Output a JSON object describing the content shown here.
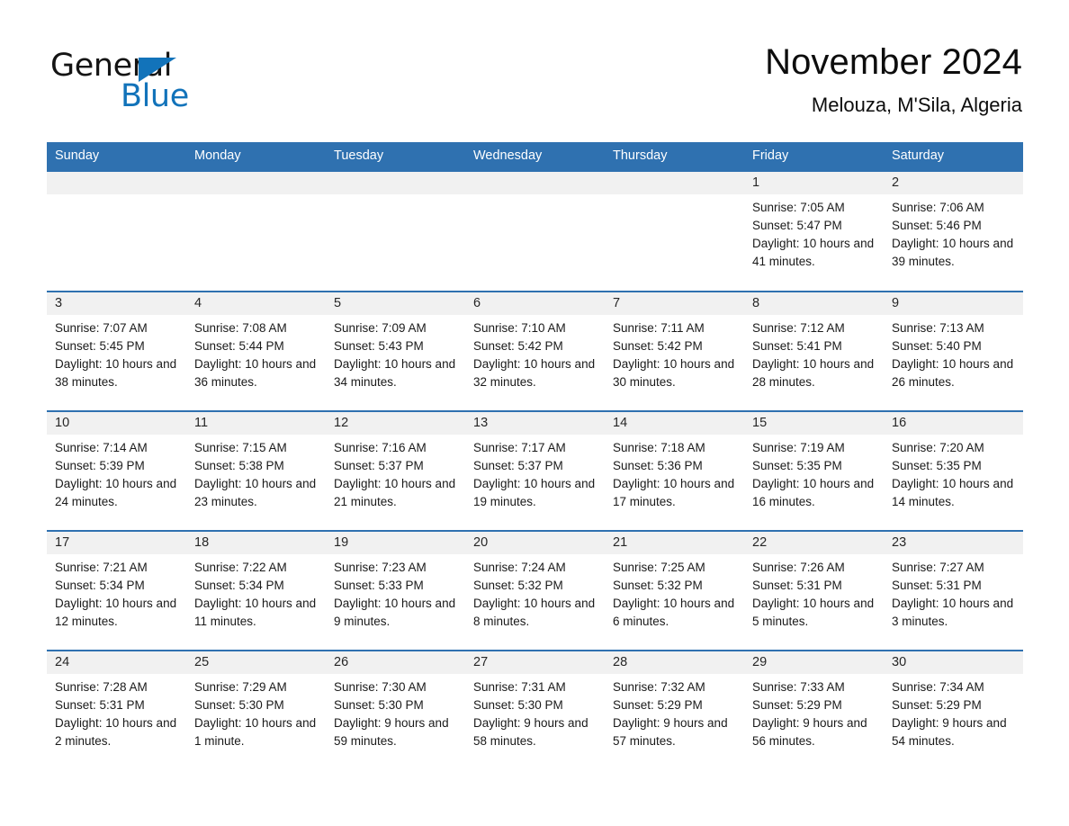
{
  "brand": {
    "word_one": "General",
    "word_two": "Blue",
    "triangle_icon": "triangle-icon",
    "accent_color": "#1273ba"
  },
  "header": {
    "title": "November 2024",
    "subtitle": "Melouza, M'Sila, Algeria"
  },
  "theme": {
    "header_blue": "#2f71b0",
    "daynum_gray": "#f1f1f1",
    "text": "#1a1a1a"
  },
  "calendar": {
    "weekday_headers": [
      "Sunday",
      "Monday",
      "Tuesday",
      "Wednesday",
      "Thursday",
      "Friday",
      "Saturday"
    ],
    "weeks": [
      [
        {
          "day": "",
          "blank": true
        },
        {
          "day": "",
          "blank": true
        },
        {
          "day": "",
          "blank": true
        },
        {
          "day": "",
          "blank": true
        },
        {
          "day": "",
          "blank": true
        },
        {
          "day": "1",
          "sunrise": "Sunrise: 7:05 AM",
          "sunset": "Sunset: 5:47 PM",
          "daylight": "Daylight: 10 hours and 41 minutes."
        },
        {
          "day": "2",
          "sunrise": "Sunrise: 7:06 AM",
          "sunset": "Sunset: 5:46 PM",
          "daylight": "Daylight: 10 hours and 39 minutes."
        }
      ],
      [
        {
          "day": "3",
          "sunrise": "Sunrise: 7:07 AM",
          "sunset": "Sunset: 5:45 PM",
          "daylight": "Daylight: 10 hours and 38 minutes."
        },
        {
          "day": "4",
          "sunrise": "Sunrise: 7:08 AM",
          "sunset": "Sunset: 5:44 PM",
          "daylight": "Daylight: 10 hours and 36 minutes."
        },
        {
          "day": "5",
          "sunrise": "Sunrise: 7:09 AM",
          "sunset": "Sunset: 5:43 PM",
          "daylight": "Daylight: 10 hours and 34 minutes."
        },
        {
          "day": "6",
          "sunrise": "Sunrise: 7:10 AM",
          "sunset": "Sunset: 5:42 PM",
          "daylight": "Daylight: 10 hours and 32 minutes."
        },
        {
          "day": "7",
          "sunrise": "Sunrise: 7:11 AM",
          "sunset": "Sunset: 5:42 PM",
          "daylight": "Daylight: 10 hours and 30 minutes."
        },
        {
          "day": "8",
          "sunrise": "Sunrise: 7:12 AM",
          "sunset": "Sunset: 5:41 PM",
          "daylight": "Daylight: 10 hours and 28 minutes."
        },
        {
          "day": "9",
          "sunrise": "Sunrise: 7:13 AM",
          "sunset": "Sunset: 5:40 PM",
          "daylight": "Daylight: 10 hours and 26 minutes."
        }
      ],
      [
        {
          "day": "10",
          "sunrise": "Sunrise: 7:14 AM",
          "sunset": "Sunset: 5:39 PM",
          "daylight": "Daylight: 10 hours and 24 minutes."
        },
        {
          "day": "11",
          "sunrise": "Sunrise: 7:15 AM",
          "sunset": "Sunset: 5:38 PM",
          "daylight": "Daylight: 10 hours and 23 minutes."
        },
        {
          "day": "12",
          "sunrise": "Sunrise: 7:16 AM",
          "sunset": "Sunset: 5:37 PM",
          "daylight": "Daylight: 10 hours and 21 minutes."
        },
        {
          "day": "13",
          "sunrise": "Sunrise: 7:17 AM",
          "sunset": "Sunset: 5:37 PM",
          "daylight": "Daylight: 10 hours and 19 minutes."
        },
        {
          "day": "14",
          "sunrise": "Sunrise: 7:18 AM",
          "sunset": "Sunset: 5:36 PM",
          "daylight": "Daylight: 10 hours and 17 minutes."
        },
        {
          "day": "15",
          "sunrise": "Sunrise: 7:19 AM",
          "sunset": "Sunset: 5:35 PM",
          "daylight": "Daylight: 10 hours and 16 minutes."
        },
        {
          "day": "16",
          "sunrise": "Sunrise: 7:20 AM",
          "sunset": "Sunset: 5:35 PM",
          "daylight": "Daylight: 10 hours and 14 minutes."
        }
      ],
      [
        {
          "day": "17",
          "sunrise": "Sunrise: 7:21 AM",
          "sunset": "Sunset: 5:34 PM",
          "daylight": "Daylight: 10 hours and 12 minutes."
        },
        {
          "day": "18",
          "sunrise": "Sunrise: 7:22 AM",
          "sunset": "Sunset: 5:34 PM",
          "daylight": "Daylight: 10 hours and 11 minutes."
        },
        {
          "day": "19",
          "sunrise": "Sunrise: 7:23 AM",
          "sunset": "Sunset: 5:33 PM",
          "daylight": "Daylight: 10 hours and 9 minutes."
        },
        {
          "day": "20",
          "sunrise": "Sunrise: 7:24 AM",
          "sunset": "Sunset: 5:32 PM",
          "daylight": "Daylight: 10 hours and 8 minutes."
        },
        {
          "day": "21",
          "sunrise": "Sunrise: 7:25 AM",
          "sunset": "Sunset: 5:32 PM",
          "daylight": "Daylight: 10 hours and 6 minutes."
        },
        {
          "day": "22",
          "sunrise": "Sunrise: 7:26 AM",
          "sunset": "Sunset: 5:31 PM",
          "daylight": "Daylight: 10 hours and 5 minutes."
        },
        {
          "day": "23",
          "sunrise": "Sunrise: 7:27 AM",
          "sunset": "Sunset: 5:31 PM",
          "daylight": "Daylight: 10 hours and 3 minutes."
        }
      ],
      [
        {
          "day": "24",
          "sunrise": "Sunrise: 7:28 AM",
          "sunset": "Sunset: 5:31 PM",
          "daylight": "Daylight: 10 hours and 2 minutes."
        },
        {
          "day": "25",
          "sunrise": "Sunrise: 7:29 AM",
          "sunset": "Sunset: 5:30 PM",
          "daylight": "Daylight: 10 hours and 1 minute."
        },
        {
          "day": "26",
          "sunrise": "Sunrise: 7:30 AM",
          "sunset": "Sunset: 5:30 PM",
          "daylight": "Daylight: 9 hours and 59 minutes."
        },
        {
          "day": "27",
          "sunrise": "Sunrise: 7:31 AM",
          "sunset": "Sunset: 5:30 PM",
          "daylight": "Daylight: 9 hours and 58 minutes."
        },
        {
          "day": "28",
          "sunrise": "Sunrise: 7:32 AM",
          "sunset": "Sunset: 5:29 PM",
          "daylight": "Daylight: 9 hours and 57 minutes."
        },
        {
          "day": "29",
          "sunrise": "Sunrise: 7:33 AM",
          "sunset": "Sunset: 5:29 PM",
          "daylight": "Daylight: 9 hours and 56 minutes."
        },
        {
          "day": "30",
          "sunrise": "Sunrise: 7:34 AM",
          "sunset": "Sunset: 5:29 PM",
          "daylight": "Daylight: 9 hours and 54 minutes."
        }
      ]
    ]
  }
}
